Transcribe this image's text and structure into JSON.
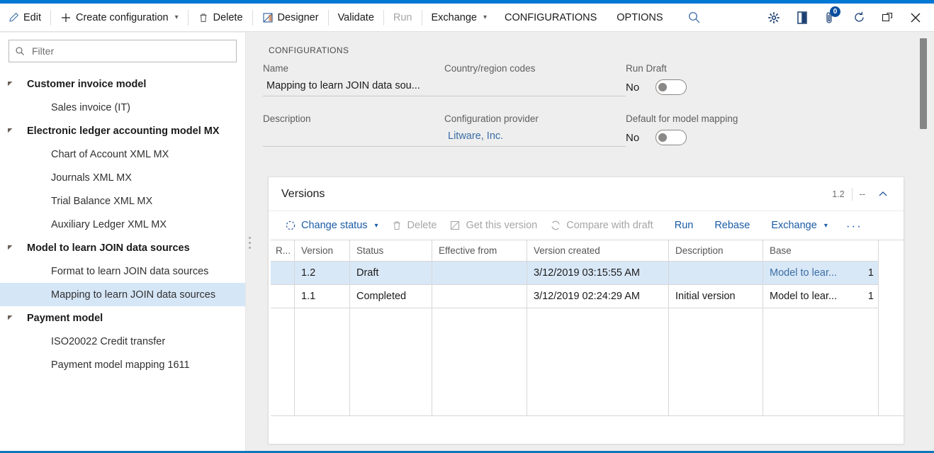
{
  "app": {
    "accent": "#0078d4",
    "selection_bg": "#d5e6f7"
  },
  "command_bar": {
    "buttons": [
      {
        "label": "Edit",
        "icon": "pencil-icon",
        "enabled": true,
        "caret": false
      },
      {
        "label": "Create configuration",
        "icon": "plus-icon",
        "enabled": true,
        "caret": true
      },
      {
        "label": "Delete",
        "icon": "trash-icon",
        "enabled": true,
        "caret": false
      },
      {
        "label": "Designer",
        "icon": "designer-icon",
        "enabled": true,
        "caret": false
      },
      {
        "label": "Validate",
        "icon": "",
        "enabled": true,
        "caret": false
      },
      {
        "label": "Run",
        "icon": "",
        "enabled": false,
        "caret": false
      },
      {
        "label": "Exchange",
        "icon": "",
        "enabled": true,
        "caret": true
      },
      {
        "label": "CONFIGURATIONS",
        "icon": "",
        "enabled": true,
        "caret": false
      },
      {
        "label": "OPTIONS",
        "icon": "",
        "enabled": true,
        "caret": false
      }
    ],
    "search_icon": "search-icon",
    "system_icons": [
      {
        "name": "settings-gear-icon",
        "badge": null
      },
      {
        "name": "help-book-icon",
        "badge": null
      },
      {
        "name": "attachments-icon",
        "badge": "0"
      },
      {
        "name": "refresh-icon",
        "badge": null
      },
      {
        "name": "open-in-new-window-icon",
        "badge": null
      },
      {
        "name": "close-icon",
        "badge": null
      }
    ]
  },
  "sidebar": {
    "filter": {
      "placeholder": "Filter",
      "value": "",
      "icon": "search-icon"
    },
    "tree": [
      {
        "label": "Customer invoice model",
        "level": 0,
        "expanded": true,
        "selected": false
      },
      {
        "label": "Sales invoice (IT)",
        "level": 1,
        "expanded": null,
        "selected": false
      },
      {
        "label": "Electronic ledger accounting model MX",
        "level": 0,
        "expanded": true,
        "selected": false
      },
      {
        "label": "Chart of Account XML MX",
        "level": 1,
        "expanded": null,
        "selected": false
      },
      {
        "label": "Journals XML MX",
        "level": 1,
        "expanded": null,
        "selected": false
      },
      {
        "label": "Trial Balance XML MX",
        "level": 1,
        "expanded": null,
        "selected": false
      },
      {
        "label": "Auxiliary Ledger XML MX",
        "level": 1,
        "expanded": null,
        "selected": false
      },
      {
        "label": "Model to learn JOIN data sources",
        "level": 0,
        "expanded": true,
        "selected": false
      },
      {
        "label": "Format to learn JOIN data sources",
        "level": 1,
        "expanded": null,
        "selected": false
      },
      {
        "label": "Mapping to learn JOIN data sources",
        "level": 1,
        "expanded": null,
        "selected": true
      },
      {
        "label": "Payment model",
        "level": 0,
        "expanded": true,
        "selected": false
      },
      {
        "label": "ISO20022 Credit transfer",
        "level": 1,
        "expanded": null,
        "selected": false
      },
      {
        "label": "Payment model mapping 1611",
        "level": 1,
        "expanded": null,
        "selected": false
      }
    ]
  },
  "main": {
    "section_title": "CONFIGURATIONS",
    "fields": {
      "name_label": "Name",
      "name_value": "Mapping to learn JOIN data sou...",
      "description_label": "Description",
      "description_value": "",
      "country_label": "Country/region codes",
      "country_value": "",
      "provider_label": "Configuration provider",
      "provider_value": "Litware, Inc.",
      "run_draft_label": "Run Draft",
      "run_draft_value": "No",
      "run_draft_on": false,
      "default_mapping_label": "Default for model mapping",
      "default_mapping_value": "No",
      "default_mapping_on": false
    },
    "versions_card": {
      "title": "Versions",
      "header_value_1": "1.2",
      "header_value_2": "--",
      "collapse_icon": "chevron-up-icon",
      "toolbar": [
        {
          "label": "Change status",
          "icon": "change-status-icon",
          "enabled": true,
          "caret": true
        },
        {
          "label": "Delete",
          "icon": "trash-icon",
          "enabled": false,
          "caret": false
        },
        {
          "label": "Get this version",
          "icon": "get-version-icon",
          "enabled": false,
          "caret": false
        },
        {
          "label": "Compare with draft",
          "icon": "compare-icon",
          "enabled": false,
          "caret": false
        },
        {
          "label": "Run",
          "icon": "",
          "enabled": true,
          "caret": false
        },
        {
          "label": "Rebase",
          "icon": "",
          "enabled": true,
          "caret": false
        },
        {
          "label": "Exchange",
          "icon": "",
          "enabled": true,
          "caret": true
        }
      ],
      "overflow_label": "···",
      "columns": [
        "R...",
        "Version",
        "Status",
        "Effective from",
        "Version created",
        "Description",
        "Base"
      ],
      "rows": [
        {
          "r": "",
          "version": "1.2",
          "status": "Draft",
          "effective_from": "",
          "version_created": "3/12/2019 03:15:55 AM",
          "description": "",
          "base": "Model to lear...",
          "base_num": "1",
          "base_is_link": true,
          "has_calendar": true,
          "selected": true
        },
        {
          "r": "",
          "version": "1.1",
          "status": "Completed",
          "effective_from": "",
          "version_created": "3/12/2019 02:24:29 AM",
          "description": "Initial version",
          "base": "Model to lear...",
          "base_num": "1",
          "base_is_link": false,
          "has_calendar": false,
          "selected": false
        }
      ]
    }
  }
}
